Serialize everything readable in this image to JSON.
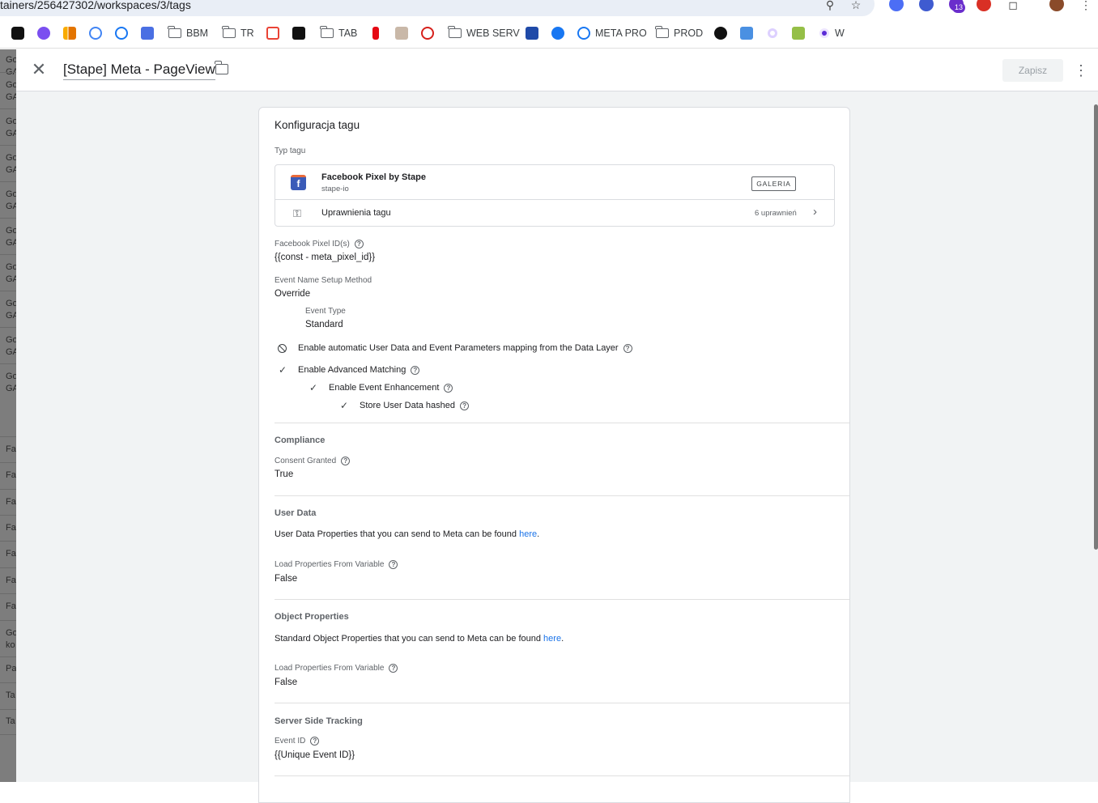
{
  "browser": {
    "url": "tainers/256427302/workspaces/3/tags",
    "ext_badge": "13",
    "bookmarks": [
      {
        "label": ""
      },
      {
        "label": ""
      },
      {
        "label": ""
      },
      {
        "label": ""
      },
      {
        "label": ""
      },
      {
        "label": ""
      },
      {
        "label": "BBM"
      },
      {
        "label": "TR"
      },
      {
        "label": ""
      },
      {
        "label": ""
      },
      {
        "label": "TAB"
      },
      {
        "label": ""
      },
      {
        "label": ""
      },
      {
        "label": ""
      },
      {
        "label": "WEB SERV"
      },
      {
        "label": ""
      },
      {
        "label": ""
      },
      {
        "label": "META PRO"
      },
      {
        "label": "PROD"
      },
      {
        "label": ""
      },
      {
        "label": ""
      },
      {
        "label": ""
      },
      {
        "label": ""
      },
      {
        "label": "W"
      }
    ]
  },
  "background_list": [
    "Go GA",
    "Go GA",
    "Go GA",
    "Go GA",
    "Go GA",
    "Go GA",
    "Go GA",
    "Go GA",
    "Go GA",
    "Go GA",
    "Fa",
    "Fa",
    "Fa",
    "Fa",
    "Fa",
    "Fa",
    "Fa",
    "Go ko",
    "Pa",
    "Ta",
    "Ta"
  ],
  "header": {
    "tag_name": "[Stape] Meta - PageView",
    "save_label": "Zapisz"
  },
  "card": {
    "title": "Konfiguracja tagu",
    "type_label": "Typ tagu",
    "template_name": "Facebook Pixel by Stape",
    "template_vendor": "stape-io",
    "gallery_label": "GALERIA",
    "permissions_label": "Uprawnienia tagu",
    "permissions_count": "6 uprawnień",
    "pixel_id_label": "Facebook Pixel ID(s)",
    "pixel_id_value": "{{const - meta_pixel_id}}",
    "event_method_label": "Event Name Setup Method",
    "event_method_value": "Override",
    "event_type_label": "Event Type",
    "event_type_value": "Standard",
    "auto_mapping_label": "Enable automatic User Data and Event Parameters mapping from the Data Layer",
    "adv_matching_label": "Enable Advanced Matching",
    "event_enhancement_label": "Enable Event Enhancement",
    "store_hashed_label": "Store User Data hashed",
    "compliance": {
      "title": "Compliance",
      "consent_label": "Consent Granted",
      "consent_value": "True"
    },
    "user_data": {
      "title": "User Data",
      "desc": "User Data Properties that you can send to Meta can be found ",
      "link": "here",
      "load_label": "Load Properties From Variable",
      "load_value": "False"
    },
    "object_props": {
      "title": "Object Properties",
      "desc": "Standard Object Properties that you can send to Meta can be found ",
      "link": "here",
      "load_label": "Load Properties From Variable",
      "load_value": "False"
    },
    "sst": {
      "title": "Server Side Tracking",
      "event_id_label": "Event ID",
      "event_id_value": "{{Unique Event ID}}"
    }
  }
}
